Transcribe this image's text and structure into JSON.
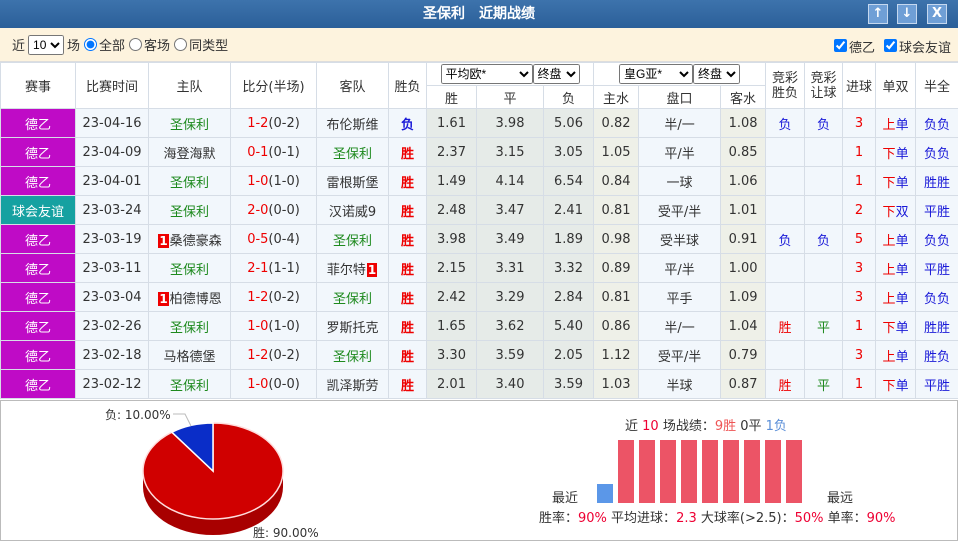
{
  "title": "圣保利　近期战绩",
  "title_buttons": {
    "up": "↑",
    "down": "↓",
    "close": "X"
  },
  "filter": {
    "prefix": "近",
    "count": "10",
    "suffix": "场",
    "opt_all": "全部",
    "opt_away": "客场",
    "opt_same": "同类型",
    "check1": "德乙",
    "check2": "球会友谊"
  },
  "headers": {
    "league": "赛事",
    "time": "比赛时间",
    "home": "主队",
    "score": "比分(半场)",
    "away": "客队",
    "result": "胜负",
    "euro_select": "平均欧*",
    "euro_type": "终盘",
    "asia_select": "皇G亚*",
    "asia_type": "终盘",
    "jc_wl": "竞彩胜负",
    "jc_rq": "竞彩让球",
    "goals": "进球",
    "ds": "单双",
    "hf": "半全",
    "win": "胜",
    "draw": "平",
    "loss": "负",
    "hw": "主水",
    "hcap": "盘口",
    "aw": "客水"
  },
  "colors": {
    "league_bundesliga2": "#bf0bc6",
    "league_friendly": "#16a1a1",
    "win": "#e00",
    "loss": "#1a1ad8",
    "team": "#1e8a1e"
  },
  "rows": [
    {
      "league": "德乙",
      "lt": "b",
      "date": "23-04-16",
      "home": "圣保利",
      "hrc": "",
      "score": "1-2",
      "half": "(0-2)",
      "away": "布伦斯维",
      "arc": "",
      "sp": "h",
      "res": "负",
      "o": [
        "1.61",
        "3.98",
        "5.06"
      ],
      "hw": "0.82",
      "hc": "半/一",
      "aw": "1.08",
      "jw": "负",
      "jr": "负",
      "g": "3",
      "ds": "上单",
      "hf": "负负"
    },
    {
      "league": "德乙",
      "lt": "b",
      "date": "23-04-09",
      "home": "海登海默",
      "hrc": "",
      "score": "0-1",
      "half": "(0-1)",
      "away": "圣保利",
      "arc": "",
      "sp": "a",
      "res": "胜",
      "o": [
        "2.37",
        "3.15",
        "3.05"
      ],
      "hw": "1.05",
      "hc": "平/半",
      "aw": "0.85",
      "jw": "",
      "jr": "",
      "g": "1",
      "ds": "下单",
      "hf": "负负"
    },
    {
      "league": "德乙",
      "lt": "b",
      "date": "23-04-01",
      "home": "圣保利",
      "hrc": "",
      "score": "1-0",
      "half": "(1-0)",
      "away": "雷根斯堡",
      "arc": "",
      "sp": "h",
      "res": "胜",
      "o": [
        "1.49",
        "4.14",
        "6.54"
      ],
      "hw": "0.84",
      "hc": "一球",
      "aw": "1.06",
      "jw": "",
      "jr": "",
      "g": "1",
      "ds": "下单",
      "hf": "胜胜"
    },
    {
      "league": "球会友谊",
      "lt": "f",
      "date": "23-03-24",
      "home": "圣保利",
      "hrc": "",
      "score": "2-0",
      "half": "(0-0)",
      "away": "汉诺威9",
      "arc": "",
      "sp": "h",
      "res": "胜",
      "o": [
        "2.48",
        "3.47",
        "2.41"
      ],
      "hw": "0.81",
      "hc": "受平/半",
      "aw": "1.01",
      "jw": "",
      "jr": "",
      "g": "2",
      "ds": "下双",
      "hf": "平胜"
    },
    {
      "league": "德乙",
      "lt": "b",
      "date": "23-03-19",
      "home": "桑德豪森",
      "hrc": "1",
      "score": "0-5",
      "half": "(0-4)",
      "away": "圣保利",
      "arc": "",
      "sp": "a",
      "res": "胜",
      "o": [
        "3.98",
        "3.49",
        "1.89"
      ],
      "hw": "0.98",
      "hc": "受半球",
      "aw": "0.91",
      "jw": "负",
      "jr": "负",
      "g": "5",
      "ds": "上单",
      "hf": "负负"
    },
    {
      "league": "德乙",
      "lt": "b",
      "date": "23-03-11",
      "home": "圣保利",
      "hrc": "",
      "score": "2-1",
      "half": "(1-1)",
      "away": "菲尔特",
      "arc": "1",
      "sp": "h",
      "res": "胜",
      "o": [
        "2.15",
        "3.31",
        "3.32"
      ],
      "hw": "0.89",
      "hc": "平/半",
      "aw": "1.00",
      "jw": "",
      "jr": "",
      "g": "3",
      "ds": "上单",
      "hf": "平胜"
    },
    {
      "league": "德乙",
      "lt": "b",
      "date": "23-03-04",
      "home": "柏德博恩",
      "hrc": "1",
      "score": "1-2",
      "half": "(0-2)",
      "away": "圣保利",
      "arc": "",
      "sp": "a",
      "res": "胜",
      "o": [
        "2.42",
        "3.29",
        "2.84"
      ],
      "hw": "0.81",
      "hc": "平手",
      "aw": "1.09",
      "jw": "",
      "jr": "",
      "g": "3",
      "ds": "上单",
      "hf": "负负"
    },
    {
      "league": "德乙",
      "lt": "b",
      "date": "23-02-26",
      "home": "圣保利",
      "hrc": "",
      "score": "1-0",
      "half": "(1-0)",
      "away": "罗斯托克",
      "arc": "",
      "sp": "h",
      "res": "胜",
      "o": [
        "1.65",
        "3.62",
        "5.40"
      ],
      "hw": "0.86",
      "hc": "半/一",
      "aw": "1.04",
      "jw": "胜",
      "jr": "平",
      "g": "1",
      "ds": "下单",
      "hf": "胜胜"
    },
    {
      "league": "德乙",
      "lt": "b",
      "date": "23-02-18",
      "home": "马格德堡",
      "hrc": "",
      "score": "1-2",
      "half": "(0-2)",
      "away": "圣保利",
      "arc": "",
      "sp": "a",
      "res": "胜",
      "o": [
        "3.30",
        "3.59",
        "2.05"
      ],
      "hw": "1.12",
      "hc": "受平/半",
      "aw": "0.79",
      "jw": "",
      "jr": "",
      "g": "3",
      "ds": "上单",
      "hf": "胜负"
    },
    {
      "league": "德乙",
      "lt": "b",
      "date": "23-02-12",
      "home": "圣保利",
      "hrc": "",
      "score": "1-0",
      "half": "(0-0)",
      "away": "凯泽斯劳",
      "arc": "",
      "sp": "h",
      "res": "胜",
      "o": [
        "2.01",
        "3.40",
        "3.59"
      ],
      "hw": "1.03",
      "hc": "半球",
      "aw": "0.87",
      "jw": "胜",
      "jr": "平",
      "g": "1",
      "ds": "下单",
      "hf": "平胜"
    }
  ],
  "pie": {
    "win_label": "胜: 90.00%",
    "loss_label": "负: 10.00%",
    "win_pct": 90,
    "loss_pct": 10
  },
  "form": {
    "p1": "近 ",
    "n": "10",
    "p2": " 场战绩：",
    "w": "9胜",
    "d": " 0平 ",
    "l": "1负",
    "recent": "最近",
    "far": "最远",
    "results": [
      "L",
      "W",
      "W",
      "W",
      "W",
      "W",
      "W",
      "W",
      "W",
      "W"
    ],
    "s1": "胜率：",
    "v1": "90%",
    "s2": " 平均进球：",
    "v2": "2.3",
    "s3": " 大球率(>2.5)：",
    "v3": "50%",
    "s4": " 单率：",
    "v4": "90%"
  }
}
